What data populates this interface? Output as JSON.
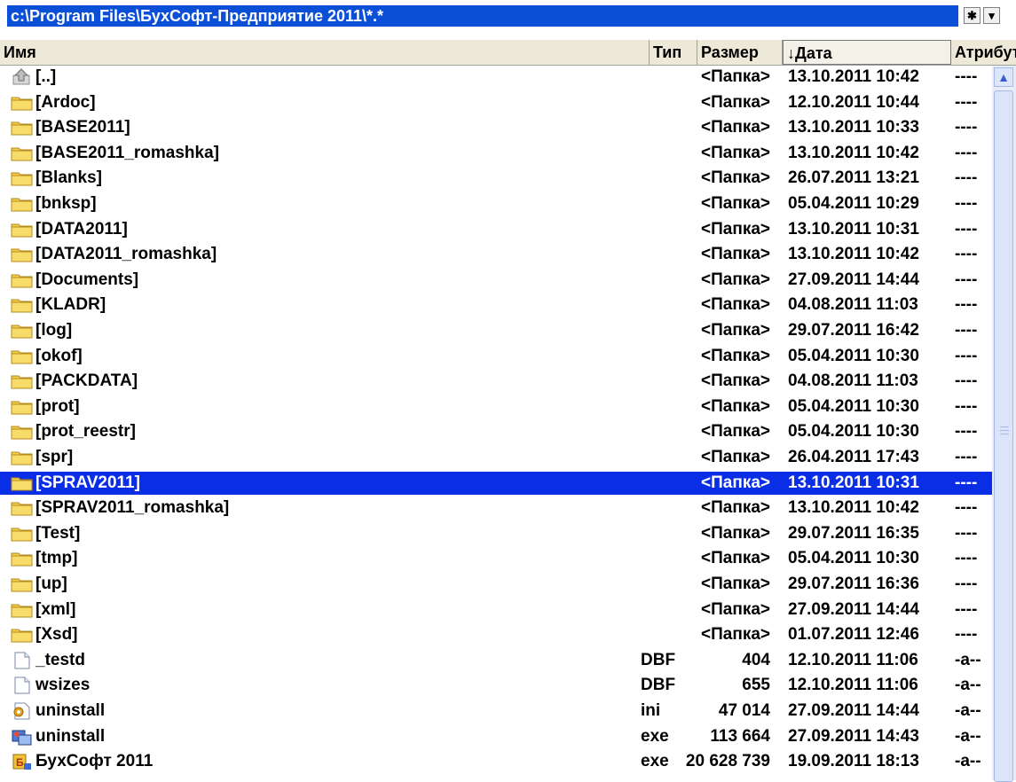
{
  "window": {
    "path": "c:\\Program Files\\БухСофт-Предприятие 2011\\*.*",
    "star_button": "✱",
    "dropdown_button": "▾"
  },
  "columns": {
    "name": "Имя",
    "type": "Тип",
    "size": "Размер",
    "date": "↓Дата",
    "attr": "Атрибут"
  },
  "rows": [
    {
      "icon": "up-folder-icon",
      "name": "[..]",
      "type": "",
      "size": "<Папка>",
      "date": "13.10.2011 10:42",
      "attr": "----"
    },
    {
      "icon": "folder-icon",
      "name": "[Ardoc]",
      "type": "",
      "size": "<Папка>",
      "date": "12.10.2011 10:44",
      "attr": "----"
    },
    {
      "icon": "folder-icon",
      "name": "[BASE2011]",
      "type": "",
      "size": "<Папка>",
      "date": "13.10.2011 10:33",
      "attr": "----"
    },
    {
      "icon": "folder-icon",
      "name": "[BASE2011_romashka]",
      "type": "",
      "size": "<Папка>",
      "date": "13.10.2011 10:42",
      "attr": "----"
    },
    {
      "icon": "folder-icon",
      "name": "[Blanks]",
      "type": "",
      "size": "<Папка>",
      "date": "26.07.2011 13:21",
      "attr": "----"
    },
    {
      "icon": "folder-icon",
      "name": "[bnksp]",
      "type": "",
      "size": "<Папка>",
      "date": "05.04.2011 10:29",
      "attr": "----"
    },
    {
      "icon": "folder-icon",
      "name": "[DATA2011]",
      "type": "",
      "size": "<Папка>",
      "date": "13.10.2011 10:31",
      "attr": "----"
    },
    {
      "icon": "folder-icon",
      "name": "[DATA2011_romashka]",
      "type": "",
      "size": "<Папка>",
      "date": "13.10.2011 10:42",
      "attr": "----"
    },
    {
      "icon": "folder-icon",
      "name": "[Documents]",
      "type": "",
      "size": "<Папка>",
      "date": "27.09.2011 14:44",
      "attr": "----"
    },
    {
      "icon": "folder-icon",
      "name": "[KLADR]",
      "type": "",
      "size": "<Папка>",
      "date": "04.08.2011 11:03",
      "attr": "----"
    },
    {
      "icon": "folder-icon",
      "name": "[log]",
      "type": "",
      "size": "<Папка>",
      "date": "29.07.2011 16:42",
      "attr": "----"
    },
    {
      "icon": "folder-icon",
      "name": "[okof]",
      "type": "",
      "size": "<Папка>",
      "date": "05.04.2011 10:30",
      "attr": "----"
    },
    {
      "icon": "folder-icon",
      "name": "[PACKDATA]",
      "type": "",
      "size": "<Папка>",
      "date": "04.08.2011 11:03",
      "attr": "----"
    },
    {
      "icon": "folder-icon",
      "name": "[prot]",
      "type": "",
      "size": "<Папка>",
      "date": "05.04.2011 10:30",
      "attr": "----"
    },
    {
      "icon": "folder-icon",
      "name": "[prot_reestr]",
      "type": "",
      "size": "<Папка>",
      "date": "05.04.2011 10:30",
      "attr": "----"
    },
    {
      "icon": "folder-icon",
      "name": "[spr]",
      "type": "",
      "size": "<Папка>",
      "date": "26.04.2011 17:43",
      "attr": "----"
    },
    {
      "icon": "folder-icon",
      "name": "[SPRAV2011]",
      "type": "",
      "size": "<Папка>",
      "date": "13.10.2011 10:31",
      "attr": "----",
      "selected": true
    },
    {
      "icon": "folder-icon",
      "name": "[SPRAV2011_romashka]",
      "type": "",
      "size": "<Папка>",
      "date": "13.10.2011 10:42",
      "attr": "----"
    },
    {
      "icon": "folder-icon",
      "name": "[Test]",
      "type": "",
      "size": "<Папка>",
      "date": "29.07.2011 16:35",
      "attr": "----"
    },
    {
      "icon": "folder-icon",
      "name": "[tmp]",
      "type": "",
      "size": "<Папка>",
      "date": "05.04.2011 10:30",
      "attr": "----"
    },
    {
      "icon": "folder-icon",
      "name": "[up]",
      "type": "",
      "size": "<Папка>",
      "date": "29.07.2011 16:36",
      "attr": "----"
    },
    {
      "icon": "folder-icon",
      "name": "[xml]",
      "type": "",
      "size": "<Папка>",
      "date": "27.09.2011 14:44",
      "attr": "----"
    },
    {
      "icon": "folder-icon",
      "name": "[Xsd]",
      "type": "",
      "size": "<Папка>",
      "date": "01.07.2011 12:46",
      "attr": "----"
    },
    {
      "icon": "file-icon",
      "name": "_testd",
      "type": "DBF",
      "size": "404",
      "date": "12.10.2011 11:06",
      "attr": "-a--"
    },
    {
      "icon": "file-icon",
      "name": "wsizes",
      "type": "DBF",
      "size": "655",
      "date": "12.10.2011 11:06",
      "attr": "-a--"
    },
    {
      "icon": "ini-file-icon",
      "name": "uninstall",
      "type": "ini",
      "size": "47 014",
      "date": "27.09.2011 14:44",
      "attr": "-a--"
    },
    {
      "icon": "setup-exe-icon",
      "name": "uninstall",
      "type": "exe",
      "size": "113 664",
      "date": "27.09.2011 14:43",
      "attr": "-a--"
    },
    {
      "icon": "app-exe-icon",
      "name": "БухСофт 2011",
      "type": "exe",
      "size": "20 628 739",
      "date": "19.09.2011 18:13",
      "attr": "-a--"
    }
  ],
  "colors": {
    "selection": "#0a2ee6",
    "path_bar": "#0a4fd6",
    "folder": "#f3cf4a"
  }
}
